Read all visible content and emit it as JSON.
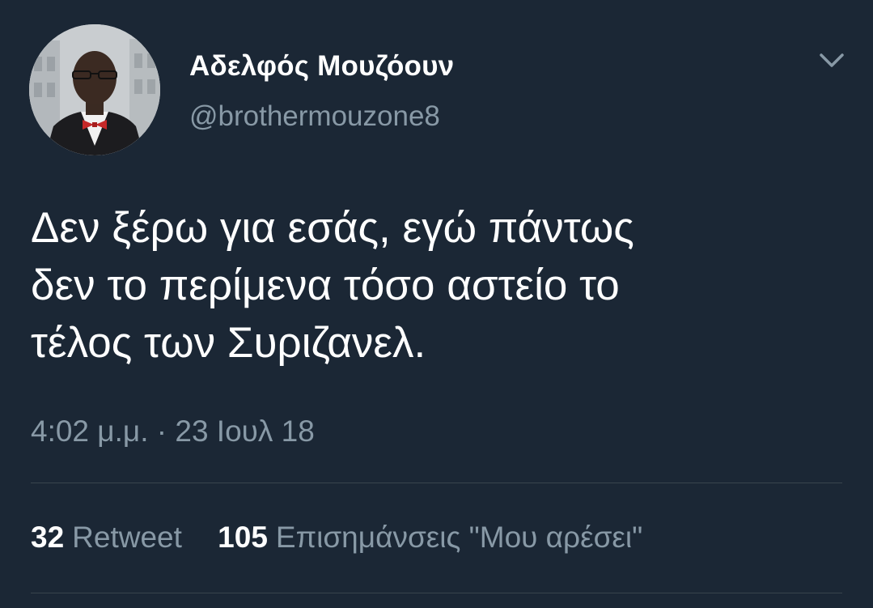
{
  "author": {
    "display_name": "Αδελφός Μουζόουν",
    "handle": "@brothermouzone8"
  },
  "tweet": {
    "lines": [
      "Δεν ξέρω για εσάς, εγώ πάντως",
      "δεν το περίμενα τόσο αστείο το",
      "τέλος των Συριζανελ."
    ],
    "timestamp": "4:02 μ.μ. · 23 Ιουλ 18"
  },
  "stats": {
    "retweets_count": "32",
    "retweets_label": "Retweet",
    "likes_count": "105",
    "likes_label": "Επισημάνσεις \"Μου αρέσει\""
  },
  "icons": {
    "menu": "chevron-down-icon"
  },
  "colors": {
    "background": "#1b2735",
    "text": "#ffffff",
    "secondary_text": "#8899a6",
    "divider": "#38444d"
  }
}
